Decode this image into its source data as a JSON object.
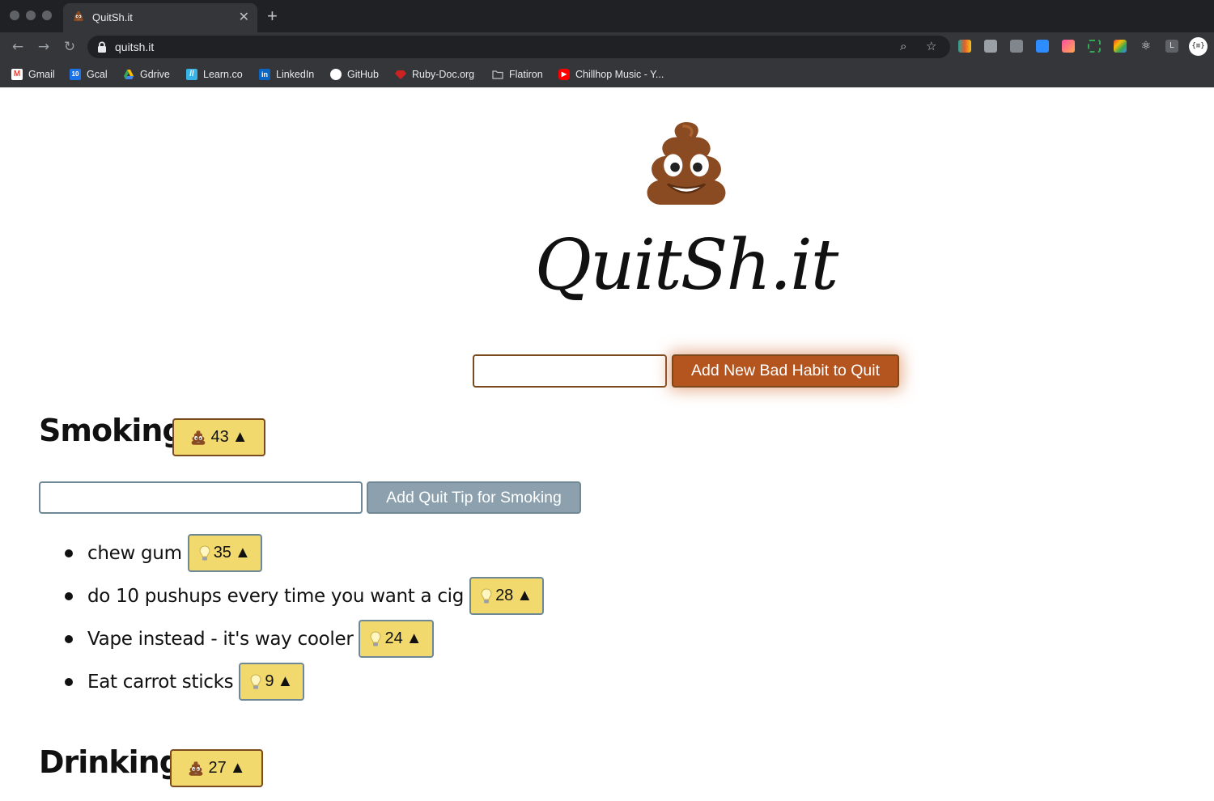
{
  "browser": {
    "tab": {
      "title": "QuitSh.it",
      "close_glyph": "✕"
    },
    "new_tab_glyph": "+",
    "url": "quitsh.it",
    "bookmarks": [
      {
        "label": "Gmail",
        "icon": "gmail-icon",
        "color": "#ea4335",
        "glyph": "M"
      },
      {
        "label": "Gcal",
        "icon": "google-calendar-icon",
        "color": "#1a73e8",
        "glyph": "10"
      },
      {
        "label": "Gdrive",
        "icon": "google-drive-icon",
        "color": "#34a853",
        "glyph": ""
      },
      {
        "label": "Learn.co",
        "icon": "learn-co-icon",
        "color": "#38b3e8",
        "glyph": "//"
      },
      {
        "label": "LinkedIn",
        "icon": "linkedin-icon",
        "color": "#0a66c2",
        "glyph": "in"
      },
      {
        "label": "GitHub",
        "icon": "github-icon",
        "color": "#ffffff",
        "glyph": ""
      },
      {
        "label": "Ruby-Doc.org",
        "icon": "ruby-doc-icon",
        "color": "#cc2222",
        "glyph": ""
      },
      {
        "label": "Flatiron",
        "icon": "folder-icon",
        "color": "#bdc1c6",
        "glyph": ""
      },
      {
        "label": "Chillhop Music - Y...",
        "icon": "youtube-icon",
        "color": "#ff0000",
        "glyph": "▶"
      }
    ],
    "profile_glyph": "{≡}"
  },
  "app": {
    "title": "QuitSh.it",
    "logo": "poop-emoji-icon",
    "new_habit_input_value": "",
    "add_habit_label": "Add New Bad Habit to Quit",
    "accent_color": "#b4541f"
  },
  "habits": [
    {
      "name": "Smoking",
      "votes": "43",
      "arrow": "▲",
      "tip_input_value": "",
      "add_tip_label": "Add Quit Tip for Smoking",
      "tips": [
        {
          "text": "chew gum",
          "votes": "35",
          "arrow": "▲"
        },
        {
          "text": "do 10 pushups every time you want a cig",
          "votes": "28",
          "arrow": "▲"
        },
        {
          "text": "Vape instead - it's way cooler",
          "votes": "24",
          "arrow": "▲"
        },
        {
          "text": "Eat carrot sticks",
          "votes": "9",
          "arrow": "▲"
        }
      ]
    },
    {
      "name": "Drinking",
      "votes": "27",
      "arrow": "▲"
    }
  ]
}
